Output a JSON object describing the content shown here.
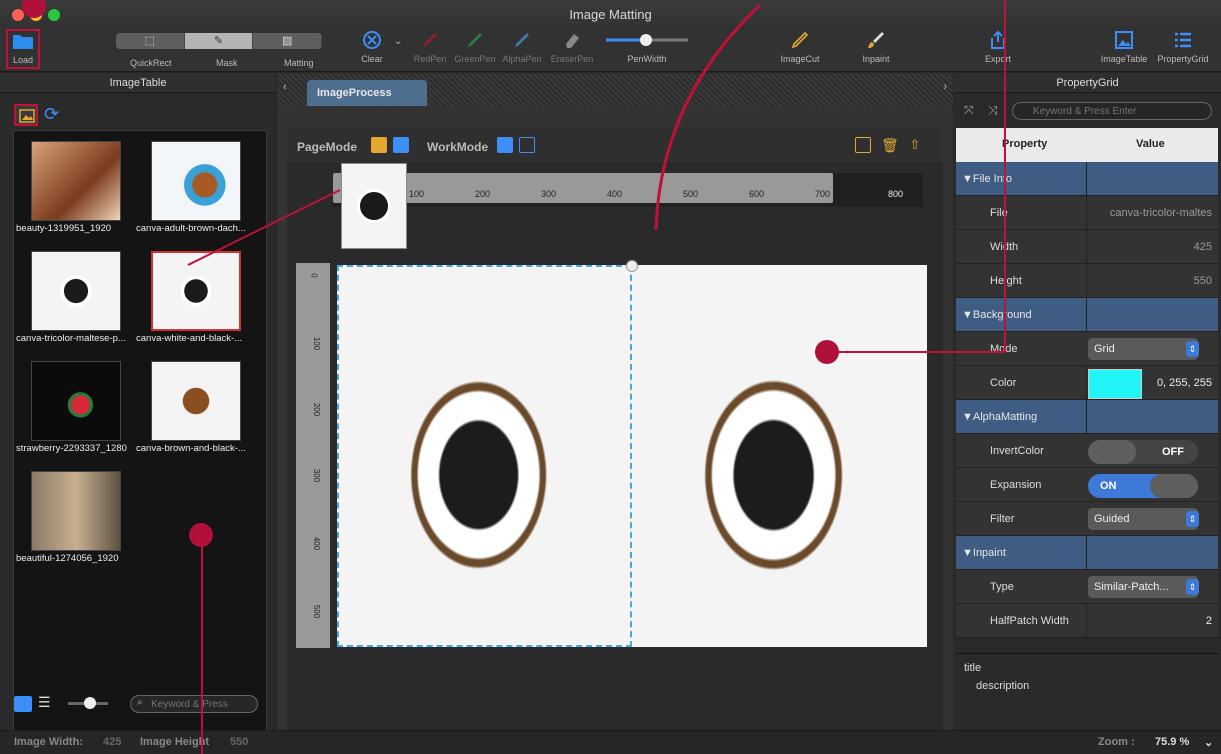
{
  "window": {
    "title": "Image Matting"
  },
  "toolbar": {
    "load": "Load",
    "quickrect": "QuickRect",
    "mask": "Mask",
    "matting": "Matting",
    "clear": "Clear",
    "redpen": "RedPen",
    "greenpen": "GreenPen",
    "alphapen": "AlphaPen",
    "eraserpen": "EraserPen",
    "penwidth": "PenWidth",
    "imagecut": "ImageCut",
    "inpaint": "Inpaint",
    "export": "Export",
    "imagetable": "ImageTable",
    "propertygrid": "PropertyGrid"
  },
  "left_panel": {
    "title": "ImageTable",
    "images": [
      {
        "name": "beauty-1319951_1920",
        "icon": "portrait-photo"
      },
      {
        "name": "canva-adult-brown-dach...",
        "icon": "dog-photo"
      },
      {
        "name": "canva-tricolor-maltese-p...",
        "icon": "puppy-photo"
      },
      {
        "name": "canva-white-and-black-...",
        "icon": "puppy-photo",
        "selected": true
      },
      {
        "name": "strawberry-2293337_1280",
        "icon": "strawberry-photo"
      },
      {
        "name": "canva-brown-and-black-...",
        "icon": "dog-photo"
      },
      {
        "name": "beautiful-1274056_1920",
        "icon": "portrait-photo"
      }
    ],
    "search_placeholder": "Keyword & Press"
  },
  "center": {
    "tab": "ImageProcess",
    "page_mode": "PageMode",
    "work_mode": "WorkMode",
    "ruler_h": [
      "100",
      "200",
      "300",
      "400",
      "500",
      "600",
      "700",
      "800"
    ],
    "ruler_v": [
      "0",
      "100",
      "200",
      "300",
      "400",
      "500"
    ]
  },
  "right_panel": {
    "title": "PropertyGrid",
    "search_placeholder": "Keyword & Press Enter",
    "col_property": "Property",
    "col_value": "Value",
    "rows": [
      {
        "type": "cat",
        "key": "▼File Info"
      },
      {
        "key": "File",
        "value": "canva-tricolor-maltes"
      },
      {
        "key": "Width",
        "value": "425"
      },
      {
        "key": "Height",
        "value": "550"
      },
      {
        "type": "cat",
        "key": "▼Background"
      },
      {
        "key": "Mode",
        "value": "Grid",
        "kind": "select"
      },
      {
        "key": "Color",
        "value": "0, 255, 255",
        "kind": "color"
      },
      {
        "type": "cat",
        "key": "▼AlphaMatting"
      },
      {
        "key": "InvertColor",
        "value": "OFF",
        "kind": "toggle-off"
      },
      {
        "key": "Expansion",
        "value": "ON",
        "kind": "toggle-on"
      },
      {
        "key": "Filter",
        "value": "Guided",
        "kind": "select"
      },
      {
        "type": "cat",
        "key": "▼Inpaint"
      },
      {
        "key": "Type",
        "value": "Similar-Patch...",
        "kind": "select"
      },
      {
        "key": "HalfPatch Width",
        "value": "2",
        "kind": "stepper"
      }
    ],
    "desc_title": "title",
    "desc_body": "description"
  },
  "status": {
    "width_label": "Image Width:",
    "width_value": "425",
    "height_label": "Image Height",
    "height_value": "550",
    "zoom_label": "Zoom :",
    "zoom_value": "75.9 %"
  },
  "colors": {
    "accent": "#3f5d82",
    "annotation": "#b0103a"
  }
}
